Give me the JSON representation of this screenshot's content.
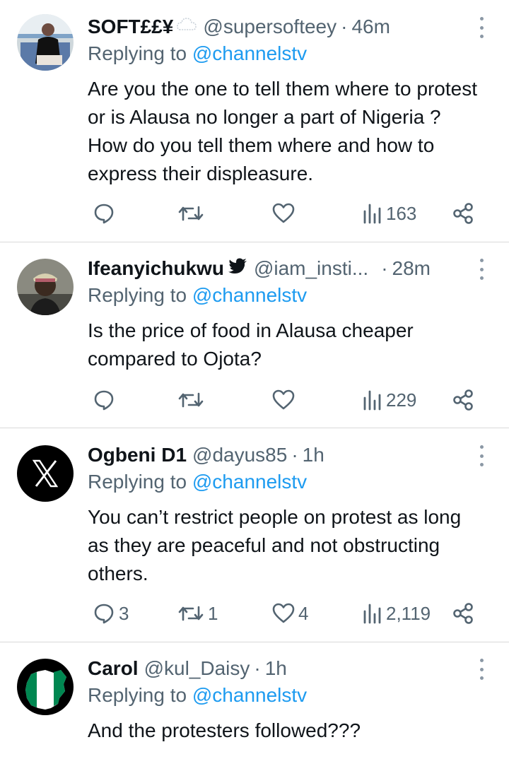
{
  "tweets": [
    {
      "name": "SOFT££¥",
      "handle": "@supersofteey",
      "time": "46m",
      "replying_label": "Replying to ",
      "replying_to": "@channelstv",
      "text": "Are you the one to tell them where to protest or is Alausa no longer a part of Nigeria ? How do you tell them where and how to express their displeasure.",
      "replies": "",
      "retweets": "",
      "likes": "",
      "views": "163",
      "avatar": "photo-avatar"
    },
    {
      "name": "Ifeanyichukwu",
      "handle": "@iam_insti...",
      "time": "28m",
      "replying_label": "Replying to ",
      "replying_to": "@channelstv",
      "text": "Is the price of food in Alausa cheaper compared to Ojota?",
      "replies": "",
      "retweets": "",
      "likes": "",
      "views": "229",
      "avatar": "photo-avatar"
    },
    {
      "name": "Ogbeni D1",
      "handle": "@dayus85",
      "time": "1h",
      "replying_label": "Replying to ",
      "replying_to": "@channelstv",
      "text": "You can’t restrict people on protest as long as they are peaceful and not obstructing others.",
      "replies": "3",
      "retweets": "1",
      "likes": "4",
      "views": "2,119",
      "avatar": "x-logo-avatar"
    },
    {
      "name": "Carol",
      "handle": "@kul_Daisy",
      "time": "1h",
      "replying_label": "Replying to ",
      "replying_to": "@channelstv",
      "text": "And the protesters followed???",
      "avatar": "nigeria-map-avatar"
    }
  ],
  "dot_separator": "·",
  "colors": {
    "link": "#1d9bf0",
    "muted": "#536471",
    "text": "#0f1419",
    "divider": "#d9d9d9"
  }
}
